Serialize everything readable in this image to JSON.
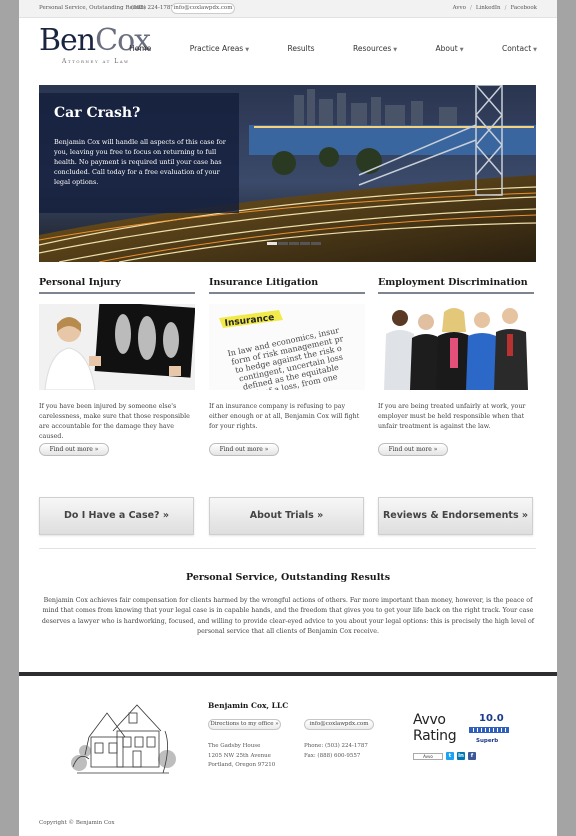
{
  "topbar": {
    "tagline": "Personal Service, Outstanding Results",
    "phone": "(503) 224-1787",
    "email": "info@coxlawpdx.com",
    "links": [
      "Avvo",
      "LinkedIn",
      "Facebook"
    ]
  },
  "logo": {
    "first": "Ben",
    "last": "Cox",
    "subtitle": "Attorney at Law"
  },
  "nav": [
    {
      "label": "Home"
    },
    {
      "label": "Practice Areas"
    },
    {
      "label": "Results"
    },
    {
      "label": "Resources"
    },
    {
      "label": "About"
    },
    {
      "label": "Contact"
    }
  ],
  "hero": {
    "title": "Car Crash?",
    "text": "Benjamin Cox will handle all aspects of this case for you, leaving you free to focus on returning to full health. No payment is required until your case has concluded. Call today for a free evaluation of your legal options."
  },
  "practice": [
    {
      "title": "Personal Injury",
      "text": "If you have been injured by someone else's carelessness, make sure that those responsible are accountable for the damage they have caused.",
      "button": "Find out more »"
    },
    {
      "title": "Insurance Litigation",
      "text": "If an insurance company is refusing to pay either enough or at all, Benjamin Cox will fight for your rights.",
      "button": "Find out more »",
      "image_words": "Insurance",
      "image_text": "In law and economics, insura form of risk management pr to hedge against the risk o contingent, uncertain loss defined as the equitable risk of a loss, from one in exchange"
    },
    {
      "title": "Employment Discrimination",
      "text": "If you are being treated unfairly at work, your employer must be held responsible when that unfair treatment is against the law.",
      "button": "Find out more »"
    }
  ],
  "cta": [
    {
      "label": "Do I Have a Case?  »"
    },
    {
      "label": "About Trials  »"
    },
    {
      "label": "Reviews & Endorsements  »"
    }
  ],
  "mission": {
    "title": "Personal Service, Outstanding Results",
    "text": "Benjamin Cox achieves fair compensation for clients harmed by the wrongful actions of others. Far more important than money, however, is the peace of mind that comes from knowing that your legal case is in capable hands, and the freedom that gives you to get your life back on the right track. Your case deserves a lawyer who is hardworking, focused, and willing to provide clear-eyed advice to you about your legal options: this is precisely the high level of personal service that all clients of Benjamin Cox receive."
  },
  "footer": {
    "firm_name": "Benjamin Cox, LLC",
    "directions_button": "Directions to my office »",
    "email": "info@coxlawpdx.com",
    "address_line1": "The Gadsby House",
    "address_line2": "1205 NW 25th Avenue",
    "address_line3": "Portland, Oregon 97210",
    "phone": "Phone: (503) 224-1787",
    "fax": "Fax: (888) 600-9557",
    "avvo_word": "Avvo",
    "avvo_rating_word": "Rating",
    "avvo_score": "10.0",
    "avvo_label": "Superb",
    "avvo_badge": "Avvo",
    "copyright_prefix": "Copyright © ",
    "copyright_name": "Benjamin Cox"
  },
  "colors": {
    "brand_navy": "#1a2540",
    "footer_bar": "#2e2e30",
    "avvo_blue": "#2f5fbf"
  }
}
